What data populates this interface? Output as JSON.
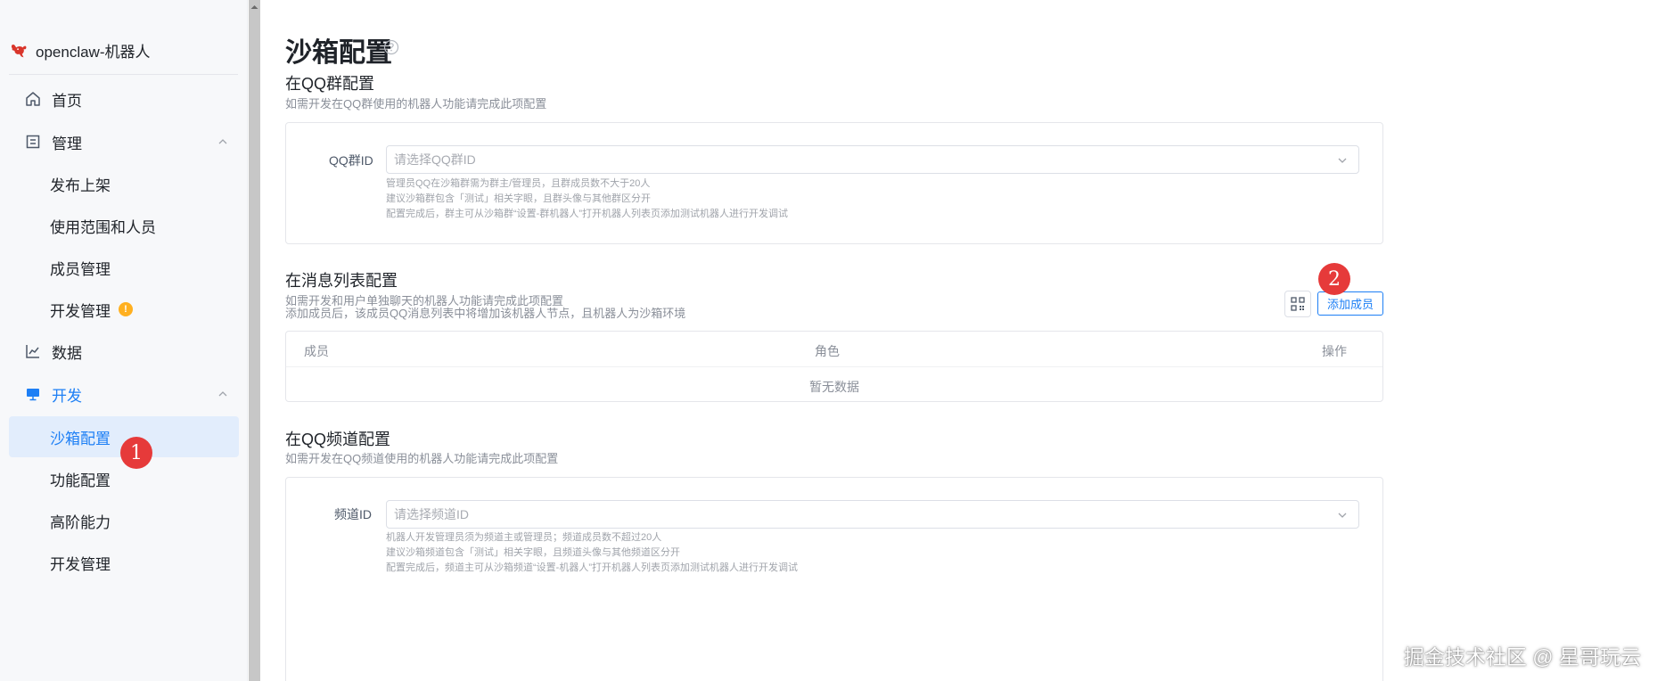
{
  "app": {
    "name": "openclaw-机器人"
  },
  "sidebar": {
    "items": [
      {
        "label": "首页",
        "icon": "home-icon"
      },
      {
        "label": "管理",
        "icon": "doc-icon",
        "expanded": true
      },
      {
        "label": "发布上架"
      },
      {
        "label": "使用范围和人员"
      },
      {
        "label": "成员管理"
      },
      {
        "label": "开发管理",
        "badge": "!"
      },
      {
        "label": "数据",
        "icon": "chart-line-icon"
      },
      {
        "label": "开发",
        "icon": "monitor-icon",
        "expanded": true
      },
      {
        "label": "沙箱配置",
        "selected": true
      },
      {
        "label": "功能配置"
      },
      {
        "label": "高阶能力"
      },
      {
        "label": "开发管理"
      }
    ]
  },
  "page": {
    "title": "沙箱配置"
  },
  "qq_group": {
    "title": "在QQ群配置",
    "desc": "如需开发在QQ群使用的机器人功能请完成此项配置",
    "field_label": "QQ群ID",
    "placeholder": "请选择QQ群ID",
    "hints": [
      "管理员QQ在沙箱群需为群主/管理员，且群成员数不大于20人",
      "建议沙箱群包含「测试」相关字眼，且群头像与其他群区分开",
      "配置完成后，群主可从沙箱群“设置-群机器人”打开机器人列表页添加测试机器人进行开发调试"
    ]
  },
  "message_list": {
    "title": "在消息列表配置",
    "desc_lines": [
      "如需开发和用户单独聊天的机器人功能请完成此项配置",
      "添加成员后，该成员QQ消息列表中将增加该机器人节点，且机器人为沙箱环境"
    ],
    "add_button": "添加成员",
    "columns": [
      "成员",
      "角色",
      "操作"
    ],
    "empty_text": "暂无数据"
  },
  "channel": {
    "title": "在QQ频道配置",
    "desc": "如需开发在QQ频道使用的机器人功能请完成此项配置",
    "field_label": "频道ID",
    "placeholder": "请选择频道ID",
    "hints": [
      "机器人开发管理员须为频道主或管理员；频道成员数不超过20人",
      "建议沙箱频道包含「测试」相关字眼，且频道头像与其他频道区分开",
      "配置完成后，频道主可从沙箱频道“设置-机器人”打开机器人列表页添加测试机器人进行开发调试"
    ]
  },
  "annotations": {
    "badge1": "1",
    "badge2": "2"
  },
  "watermark": "掘金技术社区 @ 星哥玩云",
  "colors": {
    "accent": "#1d7ff5",
    "selected_bg": "#e2edfc",
    "badge": "#e63a3a",
    "warn": "#ffb020"
  }
}
